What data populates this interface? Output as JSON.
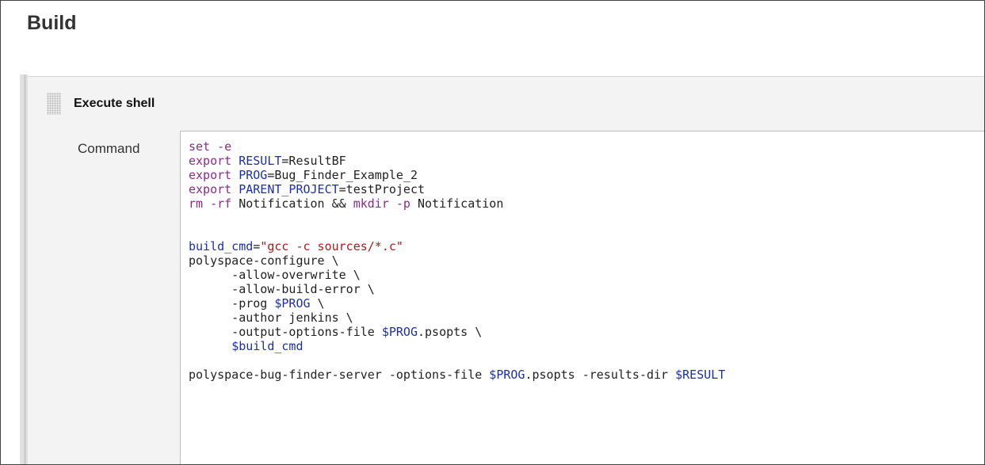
{
  "section": {
    "title": "Build"
  },
  "build_step": {
    "title": "Execute shell",
    "command_label": "Command",
    "command_lines": [
      [
        {
          "cls": "kw",
          "t": "set -e"
        }
      ],
      [
        {
          "cls": "kw",
          "t": "export "
        },
        {
          "cls": "var",
          "t": "RESULT"
        },
        {
          "cls": "plain",
          "t": "=ResultBF"
        }
      ],
      [
        {
          "cls": "kw",
          "t": "export "
        },
        {
          "cls": "var",
          "t": "PROG"
        },
        {
          "cls": "plain",
          "t": "=Bug_Finder_Example_2"
        }
      ],
      [
        {
          "cls": "kw",
          "t": "export "
        },
        {
          "cls": "var",
          "t": "PARENT_PROJECT"
        },
        {
          "cls": "plain",
          "t": "=testProject"
        }
      ],
      [
        {
          "cls": "kw",
          "t": "rm -rf"
        },
        {
          "cls": "plain",
          "t": " Notification && "
        },
        {
          "cls": "kw",
          "t": "mkdir -p"
        },
        {
          "cls": "plain",
          "t": " Notification"
        }
      ],
      [],
      [],
      [
        {
          "cls": "var",
          "t": "build_cmd"
        },
        {
          "cls": "plain",
          "t": "="
        },
        {
          "cls": "str",
          "t": "\"gcc -c sources/*.c\""
        }
      ],
      [
        {
          "cls": "plain",
          "t": "polyspace-configure \\"
        }
      ],
      [
        {
          "cls": "plain",
          "t": "      -allow-overwrite \\"
        }
      ],
      [
        {
          "cls": "plain",
          "t": "      -allow-build-error \\"
        }
      ],
      [
        {
          "cls": "plain",
          "t": "      -prog "
        },
        {
          "cls": "var",
          "t": "$PROG"
        },
        {
          "cls": "plain",
          "t": " \\"
        }
      ],
      [
        {
          "cls": "plain",
          "t": "      -author jenkins \\"
        }
      ],
      [
        {
          "cls": "plain",
          "t": "      -output-options-file "
        },
        {
          "cls": "var",
          "t": "$PROG"
        },
        {
          "cls": "plain",
          "t": ".psopts \\"
        }
      ],
      [
        {
          "cls": "plain",
          "t": "      "
        },
        {
          "cls": "var",
          "t": "$build_cmd"
        }
      ],
      [],
      [
        {
          "cls": "plain",
          "t": "polyspace-bug-finder-server -options-file "
        },
        {
          "cls": "var",
          "t": "$PROG"
        },
        {
          "cls": "plain",
          "t": ".psopts -results-dir "
        },
        {
          "cls": "var",
          "t": "$RESULT"
        }
      ]
    ]
  }
}
